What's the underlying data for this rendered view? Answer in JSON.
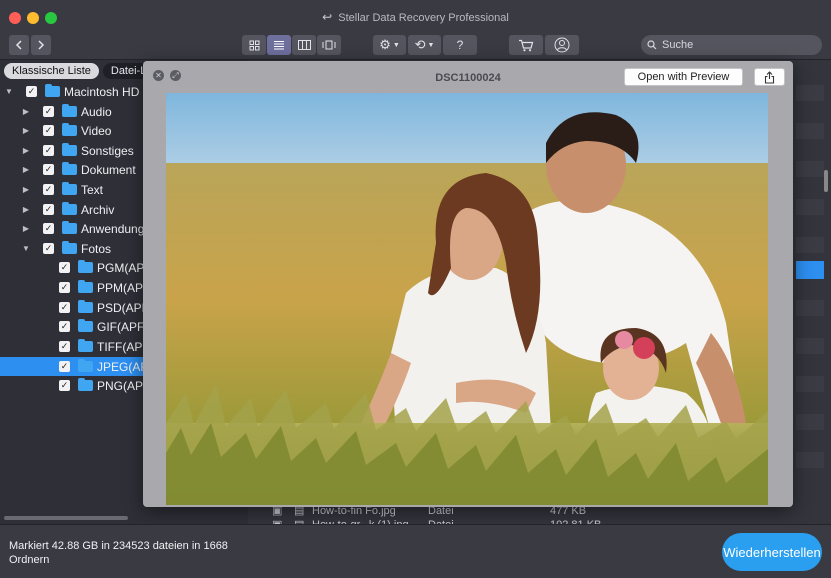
{
  "window": {
    "title": "Stellar Data Recovery Professional"
  },
  "toolbar": {
    "search_placeholder": "Suche",
    "help_label": "?",
    "view_modes": [
      "grid-view",
      "list-view",
      "column-view",
      "coverflow-view"
    ],
    "active_view": "list-view"
  },
  "sidebar": {
    "tabs": [
      "Klassische Liste",
      "Datei-Liste"
    ],
    "selected_tab": "Datei-Liste",
    "tree": [
      {
        "label": "Macintosh HD",
        "level": 0,
        "expanded": true,
        "checked": true
      },
      {
        "label": "Audio",
        "level": 1,
        "expanded": false,
        "checked": true
      },
      {
        "label": "Video",
        "level": 1,
        "expanded": false,
        "checked": true
      },
      {
        "label": "Sonstiges",
        "level": 1,
        "expanded": false,
        "checked": true
      },
      {
        "label": "Dokument",
        "level": 1,
        "expanded": false,
        "checked": true
      },
      {
        "label": "Text",
        "level": 1,
        "expanded": false,
        "checked": true
      },
      {
        "label": "Archiv",
        "level": 1,
        "expanded": false,
        "checked": true
      },
      {
        "label": "Anwendung",
        "level": 1,
        "expanded": false,
        "checked": true
      },
      {
        "label": "Fotos",
        "level": 1,
        "expanded": true,
        "checked": true
      },
      {
        "label": "PGM(APF",
        "level": 2,
        "checked": true
      },
      {
        "label": "PPM(APF",
        "level": 2,
        "checked": true
      },
      {
        "label": "PSD(APF",
        "level": 2,
        "checked": true
      },
      {
        "label": "GIF(APF",
        "level": 2,
        "checked": true
      },
      {
        "label": "TIFF(APF",
        "level": 2,
        "checked": true
      },
      {
        "label": "JPEG(AF",
        "level": 2,
        "checked": true,
        "selected": true
      },
      {
        "label": "PNG(APF",
        "level": 2,
        "checked": true
      }
    ]
  },
  "file_list": {
    "rows": [
      {
        "name": "How-to-fin Fo.jpg",
        "kind": "Datei",
        "size": "477 KB"
      },
      {
        "name": "How-to-gr...k (1).jpg",
        "kind": "Datei",
        "size": "102.81 KB"
      }
    ]
  },
  "preview": {
    "title": "DSC1100024",
    "open_with_label": "Open with Preview"
  },
  "status": {
    "summary": "Markiert 42.88 GB in 234523 dateien in 1668 Ordnern"
  },
  "actions": {
    "recover_label": "Wiederherstellen"
  },
  "colors": {
    "accent": "#2d8ff0",
    "recover_button": "#2a9ff0"
  }
}
